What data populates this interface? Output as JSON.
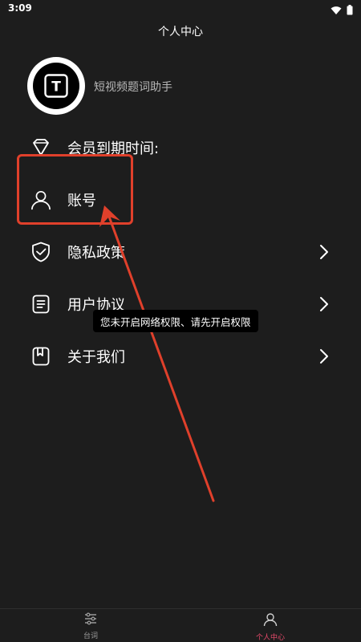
{
  "status_bar": {
    "time": "3:09"
  },
  "header": {
    "title": "个人中心"
  },
  "profile": {
    "avatar_letter": "T",
    "app_name": "短视频题词助手"
  },
  "menu": {
    "vip_label": "会员到期时间:",
    "account_label": "账号",
    "privacy_label": "隐私政策",
    "agreement_label": "用户协议",
    "about_label": "关于我们"
  },
  "toast": {
    "message": "您未开启网络权限、请先开启权限"
  },
  "bottom_nav": {
    "lines_label": "台词",
    "profile_label": "个人中心"
  },
  "colors": {
    "background": "#1d1d1d",
    "annotation_red": "#e0402b",
    "active_tab": "#e84a6b"
  }
}
